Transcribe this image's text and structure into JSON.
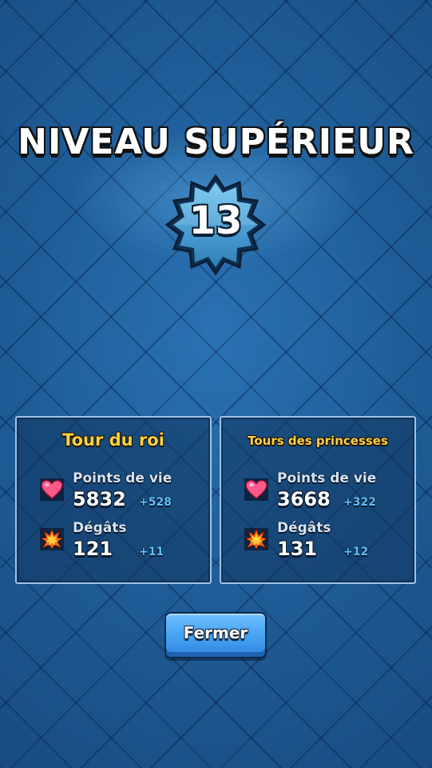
{
  "title": "NIVEAU SUPÉRIEUR",
  "level": "13",
  "panels": [
    {
      "title": "Tour du roi",
      "stats": [
        {
          "icon": "heart-icon",
          "label": "Points de vie",
          "value": "5832",
          "bonus": "+528"
        },
        {
          "icon": "explosion-icon",
          "label": "Dégâts",
          "value": "121",
          "bonus": "+11"
        }
      ]
    },
    {
      "title": "Tours des princesses",
      "stats": [
        {
          "icon": "heart-icon",
          "label": "Points de vie",
          "value": "3668",
          "bonus": "+322"
        },
        {
          "icon": "explosion-icon",
          "label": "Dégâts",
          "value": "131",
          "bonus": "+12"
        }
      ]
    }
  ],
  "close_label": "Fermer",
  "colors": {
    "background": "#1f5a93",
    "title_yellow": "#ffd147",
    "bonus_blue": "#5fc0ff",
    "button_blue": "#4aa6f5",
    "badge_blue": "#4aa3d9"
  }
}
